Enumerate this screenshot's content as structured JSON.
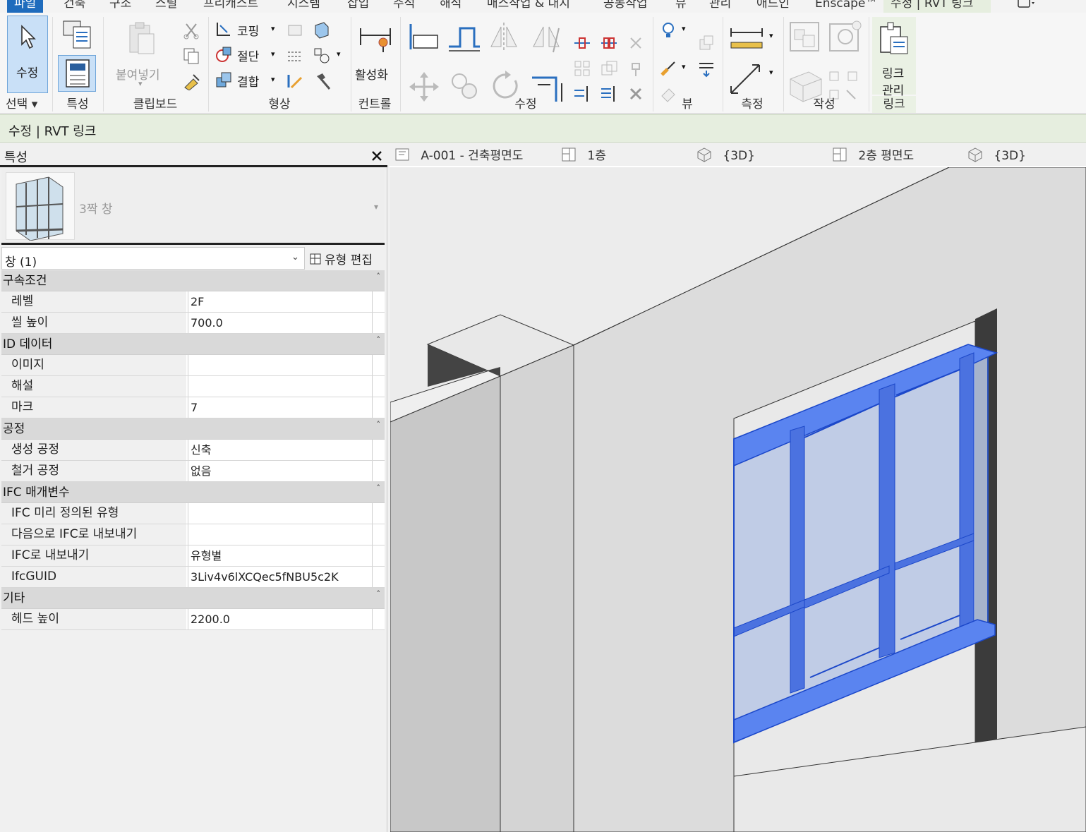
{
  "menu_tabs": [
    "파일",
    "건축",
    "구조",
    "스틸",
    "프리캐스트",
    "시스템",
    "삽입",
    "주석",
    "해석",
    "매스작업 & 대지",
    "공동작업",
    "뷰",
    "관리",
    "애드인",
    "Enscape™",
    "수정 | RVT 링크"
  ],
  "ribbon": {
    "select": {
      "modify_label": "수정",
      "panel": "선택"
    },
    "properties": {
      "panel": "특성"
    },
    "clipboard": {
      "paste_label": "붙여넣기",
      "panel": "클립보드"
    },
    "geometry": {
      "cope_label": "코핑",
      "cut_label": "절단",
      "join_label": "결합",
      "panel": "형상"
    },
    "control": {
      "activate_label": "활성화",
      "panel": "컨트롤"
    },
    "modify": {
      "panel": "수정"
    },
    "view": {
      "panel": "뷰"
    },
    "measure": {
      "panel": "측정"
    },
    "create": {
      "panel": "작성"
    },
    "link": {
      "manage_label_1": "링크",
      "manage_label_2": "관리",
      "panel": "링크"
    }
  },
  "context_bar": {
    "text": "수정 | RVT 링크"
  },
  "properties": {
    "title": "특성",
    "type_name": "3짝 창",
    "selector_value": "창 (1)",
    "edit_type_label": "유형 편집",
    "groups": [
      {
        "name": "구속조건",
        "rows": [
          {
            "k": "레벨",
            "v": "2F"
          },
          {
            "k": "씰 높이",
            "v": "700.0"
          }
        ]
      },
      {
        "name": "ID 데이터",
        "rows": [
          {
            "k": "이미지",
            "v": ""
          },
          {
            "k": "해설",
            "v": ""
          },
          {
            "k": "마크",
            "v": "7"
          }
        ]
      },
      {
        "name": "공정",
        "rows": [
          {
            "k": "생성 공정",
            "v": "신축"
          },
          {
            "k": "철거 공정",
            "v": "없음"
          }
        ]
      },
      {
        "name": "IFC 매개변수",
        "rows": [
          {
            "k": "IFC 미리 정의된 유형",
            "v": ""
          },
          {
            "k": "다음으로 IFC로 내보내기",
            "v": ""
          },
          {
            "k": "IFC로 내보내기",
            "v": "유형별"
          },
          {
            "k": "IfcGUID",
            "v": "3Liv4v6lXCQec5fNBU5c2K"
          }
        ]
      },
      {
        "name": "기타",
        "rows": [
          {
            "k": "헤드 높이",
            "v": "2200.0"
          }
        ]
      }
    ]
  },
  "view_tabs": [
    "A-001 - 건축평면도",
    "1층",
    "{3D}",
    "2층 평면도",
    "{3D}"
  ],
  "colors": {
    "file_tab": "#1f6cbd",
    "selection_blue": "#3b6ef0",
    "context_green": "#e6eedf"
  }
}
